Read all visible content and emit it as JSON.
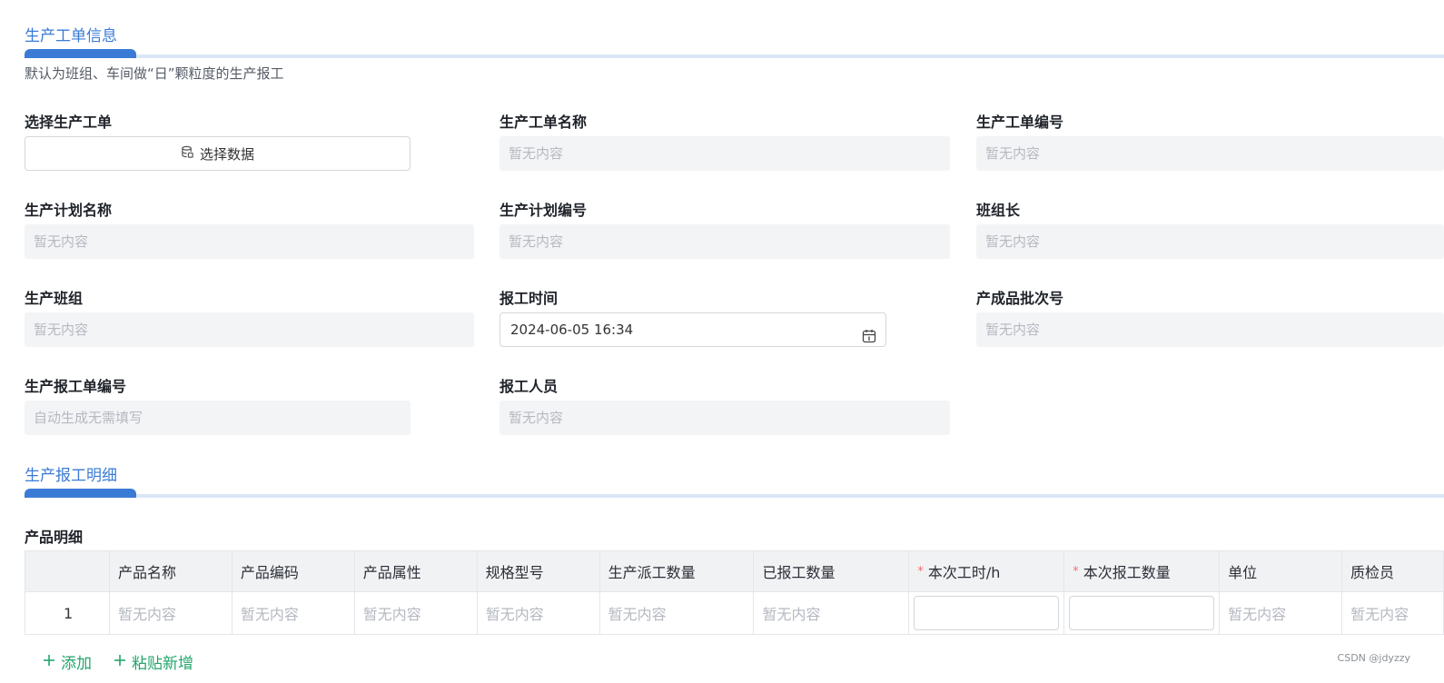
{
  "section1": {
    "title": "生产工单信息",
    "hint": "默认为班组、车间做“日”颗粒度的生产报工"
  },
  "fields": {
    "select_order": {
      "label": "选择生产工单",
      "button": "选择数据"
    },
    "order_name": {
      "label": "生产工单名称",
      "value": "暂无内容"
    },
    "order_no": {
      "label": "生产工单编号",
      "value": "暂无内容"
    },
    "plan_name": {
      "label": "生产计划名称",
      "value": "暂无内容"
    },
    "plan_no": {
      "label": "生产计划编号",
      "value": "暂无内容"
    },
    "team_leader": {
      "label": "班组长",
      "value": "暂无内容"
    },
    "team": {
      "label": "生产班组",
      "value": "暂无内容"
    },
    "report_time": {
      "label": "报工时间",
      "value": "2024-06-05 16:34"
    },
    "batch_no": {
      "label": "产成品批次号",
      "value": "暂无内容"
    },
    "report_no": {
      "label": "生产报工单编号",
      "value": "自动生成无需填写"
    },
    "reporter": {
      "label": "报工人员",
      "value": "暂无内容"
    }
  },
  "section2": {
    "title": "生产报工明细",
    "subtitle": "产品明细"
  },
  "table": {
    "headers": [
      "",
      "产品名称",
      "产品编码",
      "产品属性",
      "规格型号",
      "生产派工数量",
      "已报工数量",
      "本次工时/h",
      "本次报工数量",
      "单位",
      "质检员"
    ],
    "required_mark": "*",
    "rows": [
      [
        "1",
        "暂无内容",
        "暂无内容",
        "暂无内容",
        "暂无内容",
        "暂无内容",
        "暂无内容",
        "",
        "",
        "暂无内容",
        "暂无内容"
      ]
    ]
  },
  "actions": {
    "add": "添加",
    "paste_add": "粘贴新增"
  },
  "watermark": "CSDN @jdyzzy",
  "colors": {
    "accent": "#3a7bd5",
    "link": "#23a56c",
    "required": "#f56c6c"
  }
}
